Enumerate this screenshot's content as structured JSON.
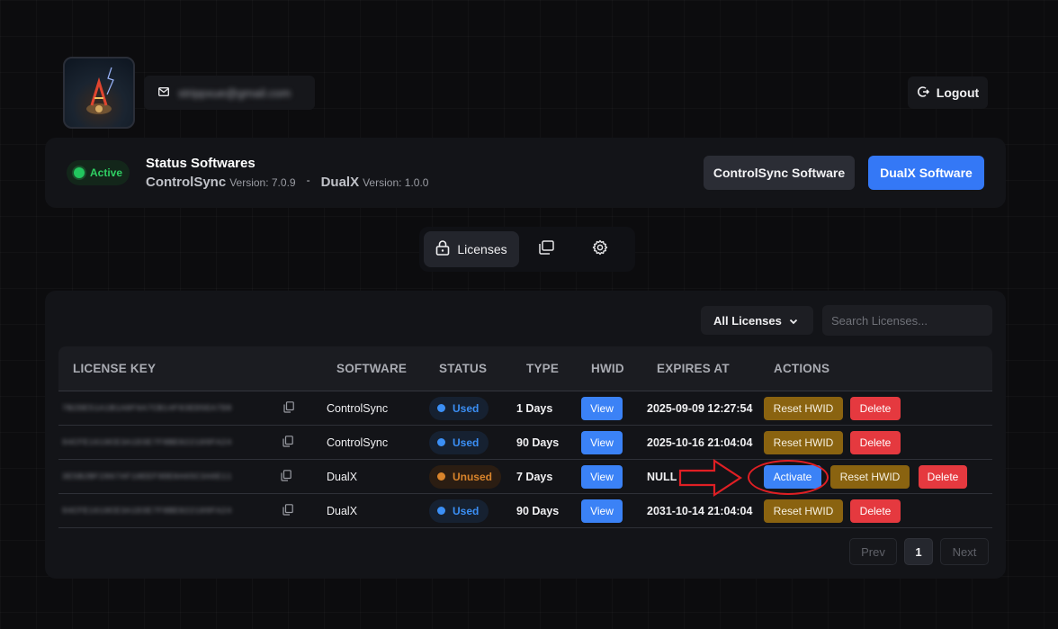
{
  "header": {
    "email": "strippxue@gmail.com",
    "logout_label": "Logout"
  },
  "status": {
    "badge_label": "Active",
    "title": "Status Softwares",
    "versions": [
      {
        "name": "ControlSync",
        "label": "Version: 7.0.9"
      },
      {
        "name": "DualX",
        "label": "Version: 1.0.0"
      }
    ],
    "separator": "-",
    "buttons": {
      "controlsync": "ControlSync Software",
      "dualx": "DualX Software"
    }
  },
  "tabs": {
    "licenses_label": "Licenses",
    "icons": [
      "lock-icon",
      "copy-pages-icon",
      "gear-icon"
    ]
  },
  "filters": {
    "select_value": "All Licenses",
    "search_placeholder": "Search Licenses..."
  },
  "table": {
    "columns": [
      "LICENSE KEY",
      "SOFTWARE",
      "STATUS",
      "TYPE",
      "HWID",
      "EXPIRES AT",
      "ACTIONS"
    ],
    "rows": [
      {
        "key": "7B2DE51A1B1A8F6A7CB14F03ED5EA7D8",
        "software": "ControlSync",
        "status": "Used",
        "type": "1 Days",
        "hwid": "View",
        "expires": "2025-09-09 12:27:54",
        "actions": [
          "Reset HWID",
          "Delete"
        ]
      },
      {
        "key": "94CFE1610CE3A1D3E7F8BE022109FA24",
        "software": "ControlSync",
        "status": "Used",
        "type": "90 Days",
        "hwid": "View",
        "expires": "2025-10-16 21:04:04",
        "actions": [
          "Reset HWID",
          "Delete"
        ]
      },
      {
        "key": "3E5B2BF2867AF10EEF9DE0A65C3A6E11",
        "software": "DualX",
        "status": "Unused",
        "type": "7 Days",
        "hwid": "View",
        "expires": "NULL",
        "actions": [
          "Activate",
          "Reset HWID",
          "Delete"
        ]
      },
      {
        "key": "94CFE1610CE3A1D3E7F8BE022109FA24",
        "software": "DualX",
        "status": "Used",
        "type": "90 Days",
        "hwid": "View",
        "expires": "2031-10-14 21:04:04",
        "actions": [
          "Reset HWID",
          "Delete"
        ]
      }
    ]
  },
  "pagination": {
    "prev": "Prev",
    "current": "1",
    "next": "Next"
  },
  "colors": {
    "accent_blue": "#3b82f6",
    "active_green": "#22c55e",
    "used_blue": "#3b8ff5",
    "unused_orange": "#d9842b",
    "reset_gold": "#8a6310",
    "delete_red": "#e5393f",
    "annotation_red": "#e01f24"
  }
}
